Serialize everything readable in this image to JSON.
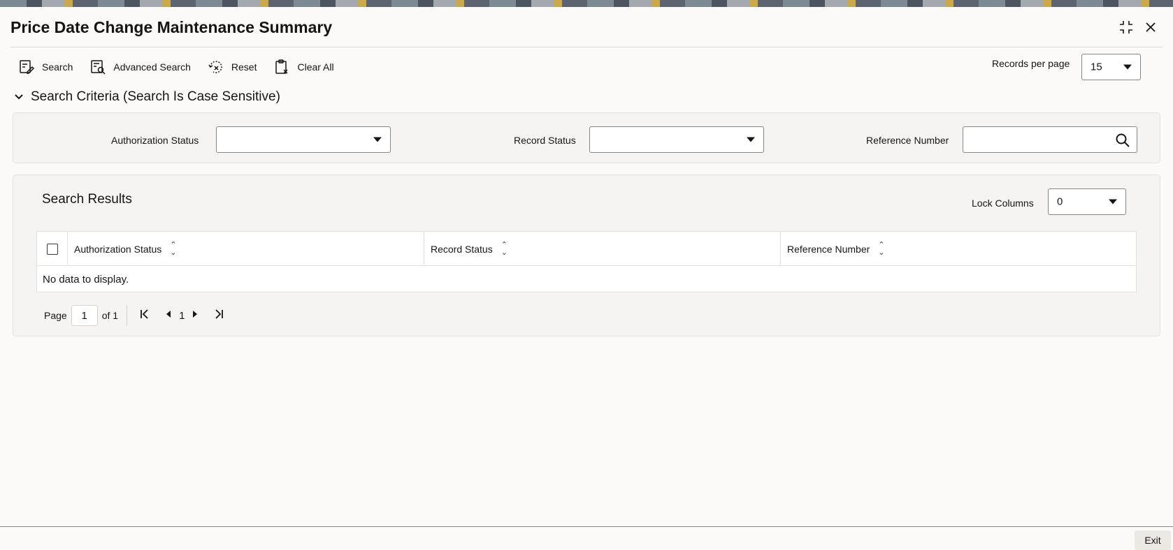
{
  "window": {
    "title": "Price Date Change Maintenance Summary"
  },
  "toolbar": {
    "search": "Search",
    "advanced_search": "Advanced Search",
    "reset": "Reset",
    "clear_all": "Clear All",
    "records_per_page_label": "Records per page",
    "records_per_page_value": "15"
  },
  "criteria": {
    "header": "Search Criteria (Search Is Case Sensitive)",
    "authorization_status_label": "Authorization Status",
    "authorization_status_value": "",
    "record_status_label": "Record Status",
    "record_status_value": "",
    "reference_number_label": "Reference Number",
    "reference_number_value": ""
  },
  "results": {
    "title": "Search Results",
    "lock_columns_label": "Lock Columns",
    "lock_columns_value": "0",
    "columns": [
      "Authorization Status",
      "Record Status",
      "Reference Number"
    ],
    "empty_text": "No data to display."
  },
  "pagination": {
    "page_label": "Page",
    "current_page": "1",
    "of_label": "of 1",
    "page_number": "1"
  },
  "footer": {
    "exit": "Exit"
  }
}
